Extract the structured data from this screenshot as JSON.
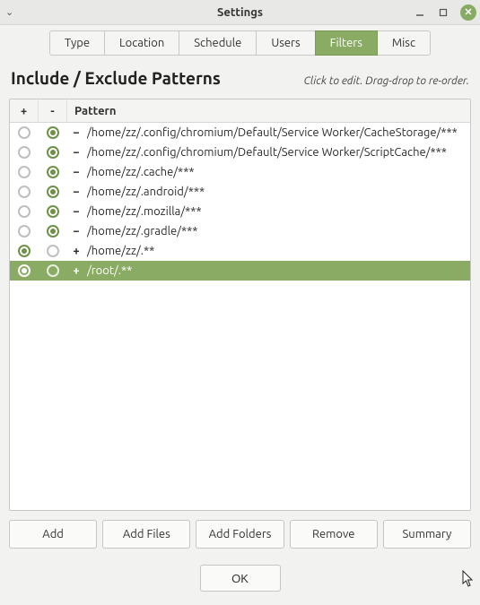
{
  "window": {
    "title": "Settings"
  },
  "tabs": [
    {
      "label": "Type"
    },
    {
      "label": "Location"
    },
    {
      "label": "Schedule"
    },
    {
      "label": "Users"
    },
    {
      "label": "Filters"
    },
    {
      "label": "Misc"
    }
  ],
  "activeTab": 4,
  "headline": "Include / Exclude Patterns",
  "hint": "Click to edit. Drag-drop to re-order.",
  "columns": {
    "plus": "+",
    "minus": "-",
    "pattern": "Pattern"
  },
  "rows": [
    {
      "include": false,
      "sign": "−",
      "path": "/home/zz/.config/chromium/Default/Service Worker/CacheStorage/***",
      "selected": false
    },
    {
      "include": false,
      "sign": "−",
      "path": "/home/zz/.config/chromium/Default/Service Worker/ScriptCache/***",
      "selected": false
    },
    {
      "include": false,
      "sign": "−",
      "path": "/home/zz/.cache/***",
      "selected": false
    },
    {
      "include": false,
      "sign": "−",
      "path": "/home/zz/.android/***",
      "selected": false
    },
    {
      "include": false,
      "sign": "−",
      "path": "/home/zz/.mozilla/***",
      "selected": false
    },
    {
      "include": false,
      "sign": "−",
      "path": "/home/zz/.gradle/***",
      "selected": false
    },
    {
      "include": true,
      "sign": "+",
      "path": "/home/zz/.**",
      "selected": false
    },
    {
      "include": true,
      "sign": "+",
      "path": "/root/.**",
      "selected": true
    }
  ],
  "buttons": {
    "add": "Add",
    "addFiles": "Add Files",
    "addFolders": "Add Folders",
    "remove": "Remove",
    "summary": "Summary",
    "ok": "OK"
  }
}
